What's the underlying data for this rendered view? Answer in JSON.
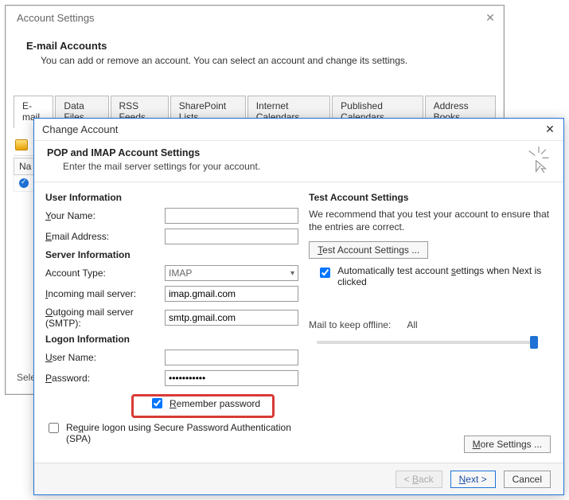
{
  "settings": {
    "title": "Account Settings",
    "heading": "E-mail Accounts",
    "subheading": "You can add or remove an account. You can select an account and change its settings.",
    "tabs": [
      "E-mail",
      "Data Files",
      "RSS Feeds",
      "SharePoint Lists",
      "Internet Calendars",
      "Published Calendars",
      "Address Books"
    ],
    "name_col": "Na",
    "selected_hint": "Sele"
  },
  "change": {
    "title": "Change Account",
    "header": "POP and IMAP Account Settings",
    "subheader": "Enter the mail server settings for your account.",
    "sections": {
      "user": "User Information",
      "server": "Server Information",
      "logon": "Logon Information",
      "test": "Test Account Settings"
    },
    "labels": {
      "your_name": "Your Name:",
      "email": "Email Address:",
      "account_type": "Account Type:",
      "incoming": "Incoming mail server:",
      "outgoing": "Outgoing mail server (SMTP):",
      "user_name": "User Name:",
      "password": "Password:",
      "remember": "Remember password",
      "spa": "Require logon using Secure Password Authentication (SPA)",
      "test_desc": "We recommend that you test your account to ensure that the entries are correct.",
      "test_btn": "Test Account Settings ...",
      "auto_test": "Automatically test account settings when Next is clicked",
      "keep_offline": "Mail to keep offline:",
      "keep_value": "All",
      "more": "More Settings ..."
    },
    "values": {
      "account_type": "IMAP",
      "incoming": "imap.gmail.com",
      "outgoing": "smtp.gmail.com",
      "password_mask": "***********"
    },
    "footer": {
      "back": "< Back",
      "next": "Next >",
      "cancel": "Cancel"
    },
    "checks": {
      "remember": true,
      "spa": false,
      "auto_test": true
    }
  }
}
